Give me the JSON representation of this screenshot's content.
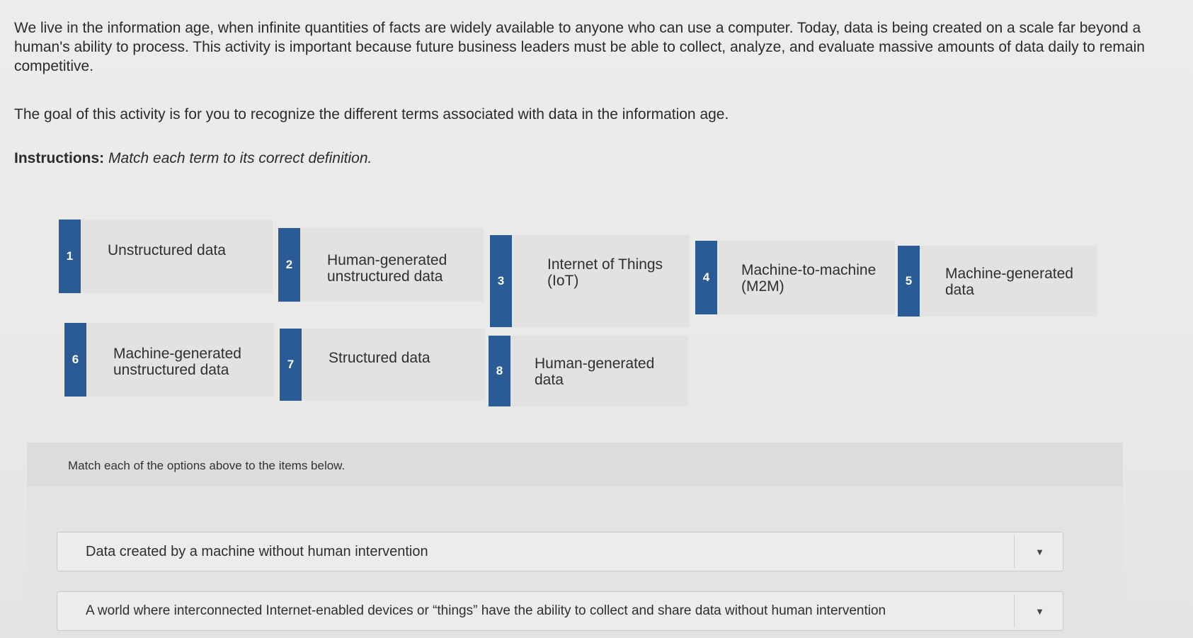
{
  "intro": {
    "paragraph": "We live in the information age, when infinite quantities of facts are widely available to anyone who can use a computer. Today, data is being created on a scale far beyond a human's ability to process. This activity is important because future business leaders must be able to collect, analyze, and evaluate massive amounts of data daily to remain competitive.",
    "goal": "The goal of this activity is for you to recognize the different terms associated with data in the information age.",
    "instructions_label": "Instructions:",
    "instructions_text": "Match each term to its correct definition."
  },
  "terms": [
    {
      "num": "1",
      "line1": "Unstructured data",
      "line2": ""
    },
    {
      "num": "2",
      "line1": "Human-generated",
      "line2": "unstructured data"
    },
    {
      "num": "3",
      "line1": "Internet of Things",
      "line2": "(IoT)"
    },
    {
      "num": "4",
      "line1": "Machine-to-machine",
      "line2": "(M2M)"
    },
    {
      "num": "5",
      "line1": "Machine-generated",
      "line2": "data"
    },
    {
      "num": "6",
      "line1": "Machine-generated",
      "line2": "unstructured data"
    },
    {
      "num": "7",
      "line1": "Structured data",
      "line2": ""
    },
    {
      "num": "8",
      "line1": "Human-generated",
      "line2": "data"
    }
  ],
  "match": {
    "header": "Match each of the options above to the items below.",
    "items": [
      {
        "text": "Data created by a machine without human intervention"
      },
      {
        "text": "A world where interconnected Internet-enabled devices or “things” have the ability to collect and share data without human intervention"
      }
    ]
  },
  "colors": {
    "accent": "#2b5b94"
  },
  "icons": {
    "dropdown": "caret-down-icon"
  }
}
